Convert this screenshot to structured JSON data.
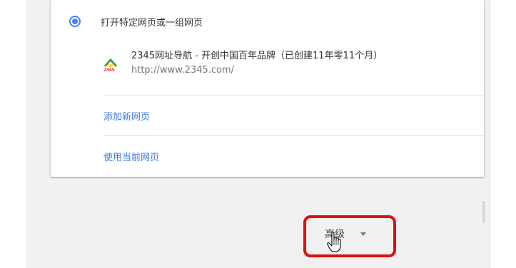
{
  "startup": {
    "radio_option_label": "打开特定网页或一组网页",
    "selected": true
  },
  "site": {
    "title": "2345网址导航 - 开创中国百年品牌（已创建11年零11个月）",
    "url": "http://www.2345.com/",
    "favicon_text": "2345"
  },
  "actions": {
    "add_page": "添加新网页",
    "use_current": "使用当前网页"
  },
  "advanced": {
    "label": "高级"
  },
  "colors": {
    "accent": "#4285f4",
    "link": "#3b78e7",
    "highlight": "#e01010"
  }
}
